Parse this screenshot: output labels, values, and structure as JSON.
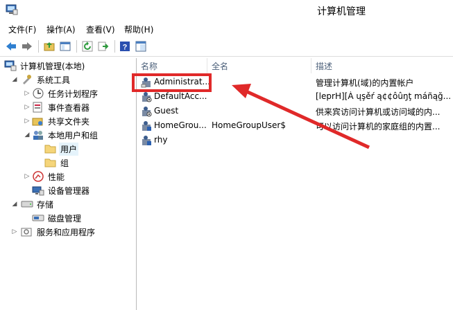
{
  "window": {
    "title": "计算机管理"
  },
  "menu": {
    "items": [
      "文件(F)",
      "操作(A)",
      "查看(V)",
      "帮助(H)"
    ]
  },
  "toolbar": {
    "buttons": [
      "back-icon",
      "forward-icon",
      "up-folder-icon",
      "show-hide-tree-icon",
      "refresh-icon",
      "export-icon",
      "help-icon",
      "properties-icon"
    ]
  },
  "tree": {
    "root": "计算机管理(本地)",
    "system_tools": "系统工具",
    "task_scheduler": "任务计划程序",
    "event_viewer": "事件查看器",
    "shared_folders": "共享文件夹",
    "local_users_groups": "本地用户和组",
    "users": "用户",
    "groups": "组",
    "performance": "性能",
    "device_manager": "设备管理器",
    "storage": "存储",
    "disk_management": "磁盘管理",
    "services_apps": "服务和应用程序"
  },
  "list": {
    "columns": [
      "名称",
      "全名",
      "描述"
    ],
    "rows": [
      {
        "name": "Administrat...",
        "fullname": "",
        "description": "管理计算机(域)的内置帐户"
      },
      {
        "name": "DefaultAcc...",
        "fullname": "",
        "description": "[leprH][À ųşěŕ ą¢¢ôûŋţ máñąğ..."
      },
      {
        "name": "Guest",
        "fullname": "",
        "description": "供来宾访问计算机或访问域的内..."
      },
      {
        "name": "HomeGrou...",
        "fullname": "HomeGroupUser$",
        "description": "可以访问计算机的家庭组的内置..."
      },
      {
        "name": "rhy",
        "fullname": "",
        "description": ""
      }
    ]
  },
  "colors": {
    "annotation_red": "#e02929",
    "header_text": "#4c607a",
    "selection": "#e5f3fb"
  }
}
